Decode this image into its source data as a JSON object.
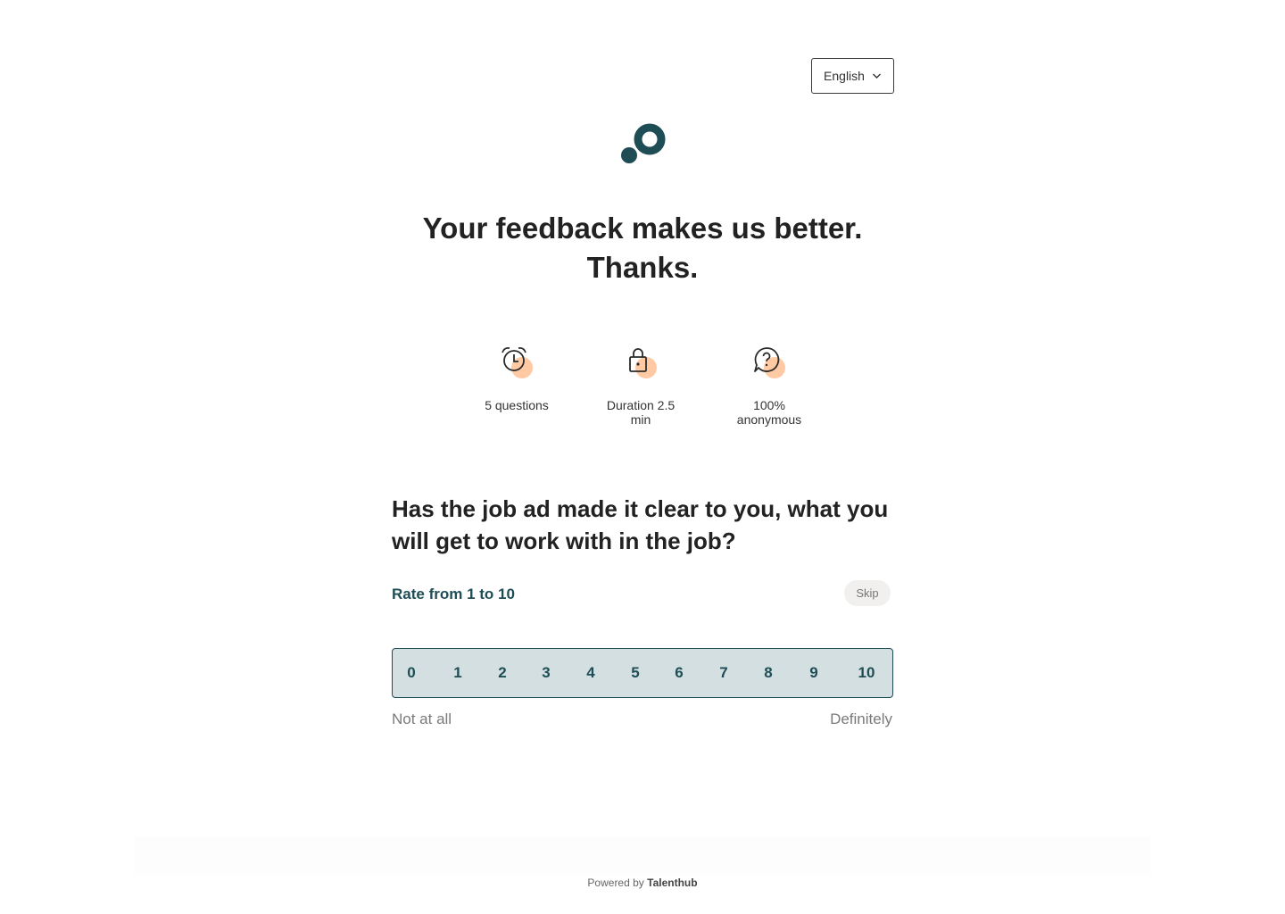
{
  "language": {
    "selected": "English"
  },
  "header": {
    "headline_line1": "Your feedback makes us better.",
    "headline_line2": "Thanks."
  },
  "facts": [
    {
      "icon": "alarm-clock-icon",
      "label": "5 questions"
    },
    {
      "icon": "lock-icon",
      "label_line1": "Duration 2.5",
      "label_line2": "min"
    },
    {
      "icon": "question-bubble-icon",
      "label_line1": "100%",
      "label_line2": "anonymous"
    }
  ],
  "question": {
    "text": "Has the job ad made it clear to you, what you will get to work with in the job?",
    "rate_label": "Rate from 1 to 10",
    "skip_label": "Skip"
  },
  "scale": {
    "options": [
      "0",
      "1",
      "2",
      "3",
      "4",
      "5",
      "6",
      "7",
      "8",
      "9",
      "10"
    ],
    "min_label": "Not at all",
    "max_label": "Definitely"
  },
  "footer": {
    "powered_prefix": "Powered by",
    "brand": "Talenthub"
  },
  "colors": {
    "brand_dark": "#1e4d55",
    "accent_peach": "#ffc9a3",
    "scale_bg": "#d3dfe0",
    "muted_text": "#7a7a7a"
  }
}
